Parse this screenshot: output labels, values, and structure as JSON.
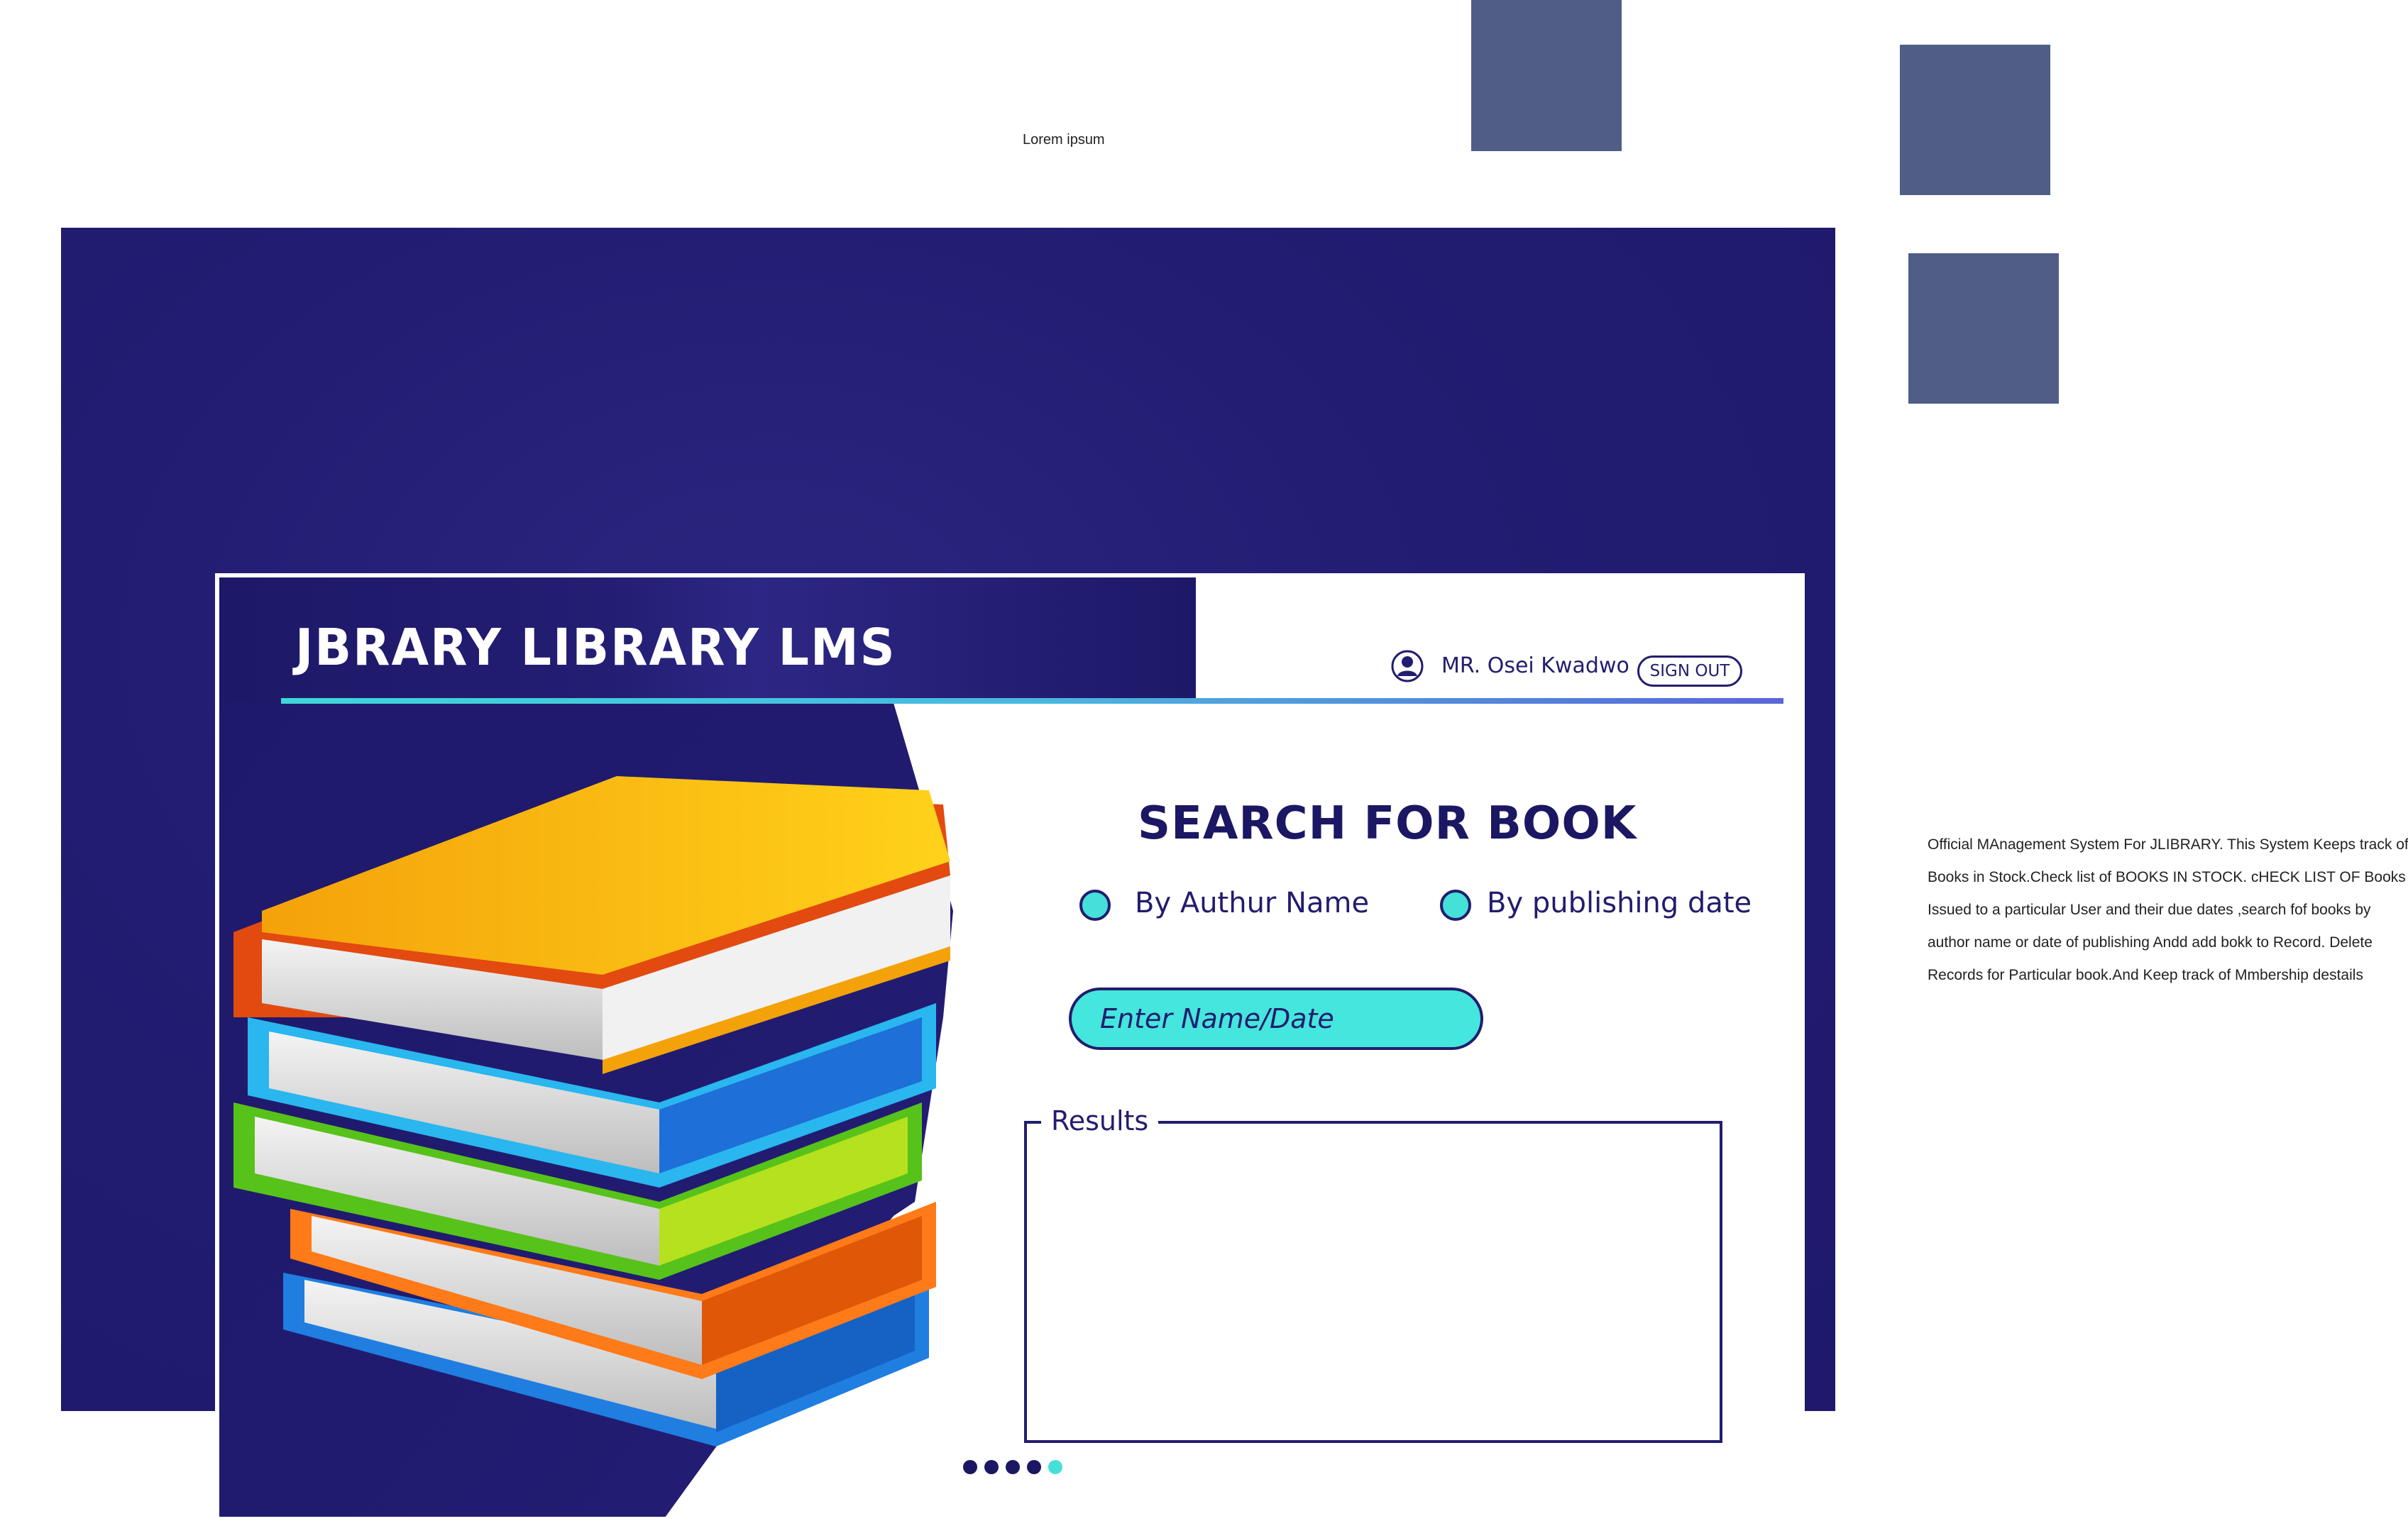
{
  "canvas_caption": "Lorem ipsum",
  "description": "Official MAnagement System For JLIBRARY.  This System Keeps track of Books in Stock.Check  list of BOOKS IN STOCK. cHECK LIST OF Books Issued to a particular User and their due dates ,search fof books by author name or date of publishing Andd add bokk to Record. Delete Records for Particular book.And Keep track of Mmbership destails",
  "app": {
    "title": "JBRARY LIBRARY LMS"
  },
  "user": {
    "name": "MR. Osei Kwadwo",
    "signout_label": "SIGN OUT"
  },
  "search": {
    "title": "SEARCH FOR BOOK",
    "options": [
      {
        "label": "By Authur Name",
        "selected": true
      },
      {
        "label": "By publishing date",
        "selected": true
      }
    ],
    "placeholder": "Enter Name/Date",
    "value": ""
  },
  "results": {
    "label": "Results"
  },
  "pagination": {
    "total": 5,
    "current": 5
  },
  "colors": {
    "navy": "#221d6e",
    "accent_cyan": "#45e0d8",
    "swatch": "#4f5d87"
  }
}
